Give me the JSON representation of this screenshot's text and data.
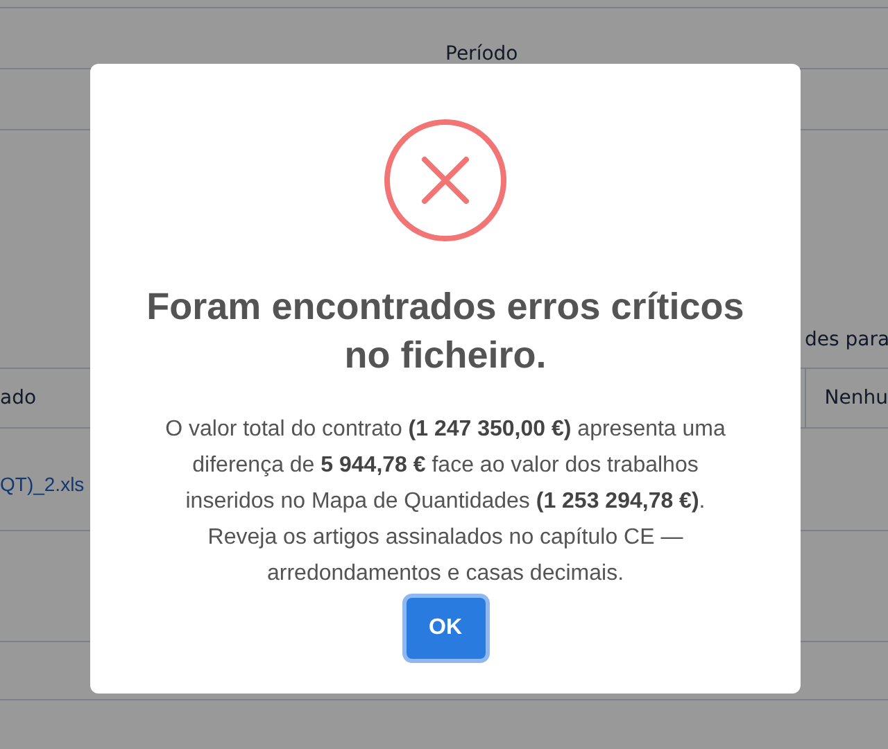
{
  "background": {
    "header": "Período",
    "note": "des para",
    "columns": [
      {
        "label": "ado"
      },
      {
        "label": "Nenhu"
      }
    ],
    "rows": [
      {
        "file": "QT)_2.xls"
      }
    ]
  },
  "dialog": {
    "kind": "error",
    "title": "Foram encontrados erros críticos no ficheiro.",
    "message": "O valor total do contrato **(1 247 350,00 €)** apresenta uma diferença de **5 944,78 €** face ao valor dos trabalhos inseridos no Mapa de Quantidades **(1 253 294,78 €)**. Reveja os artigos assinalados no capítulo CE — arredondamentos e casas decimais.",
    "buttons": [
      {
        "label": "OK",
        "focused": true
      }
    ]
  }
}
